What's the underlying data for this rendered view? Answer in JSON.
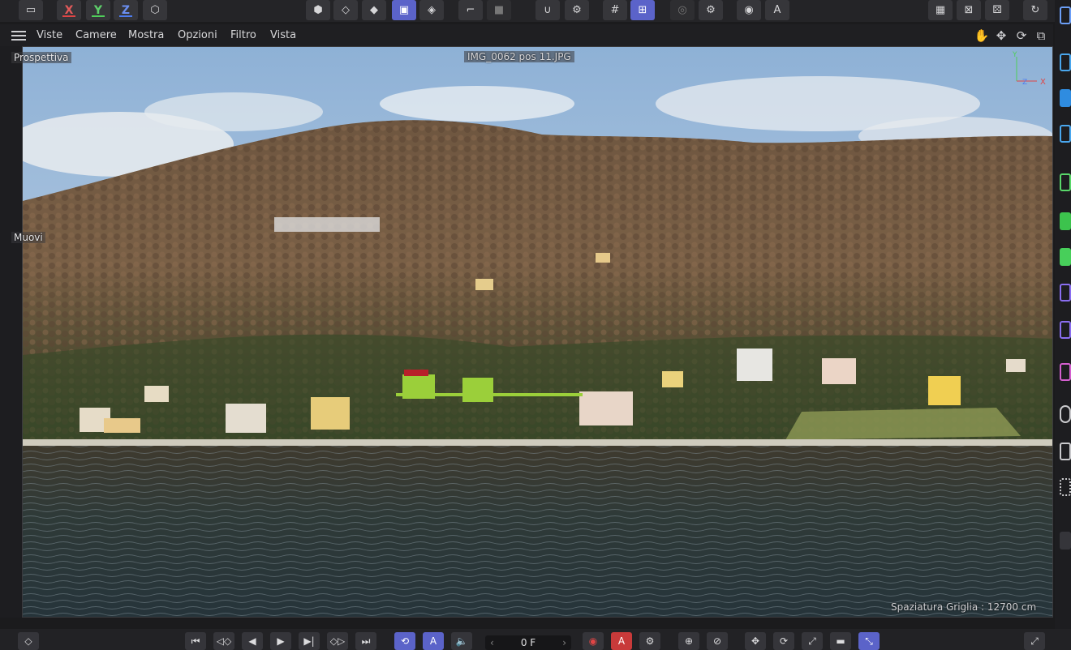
{
  "toolbar": {
    "axis_x": "X",
    "axis_y": "Y",
    "axis_z": "Z",
    "axis_colors": {
      "x": "#e04545",
      "y": "#4fcf5a",
      "z": "#4d7cf0"
    }
  },
  "menu": {
    "items": [
      "Viste",
      "Camere",
      "Mostra",
      "Opzioni",
      "Filtro",
      "Vista"
    ]
  },
  "viewport": {
    "camera_name": "Prospettiva",
    "background_image": "IMG_0062 pos 11.JPG",
    "tool_hint": "Muovi",
    "grid_spacing": "Spaziatura Griglia : 12700 cm",
    "accent": "#5b63c9"
  },
  "timeline": {
    "current_frame": "0 F"
  }
}
